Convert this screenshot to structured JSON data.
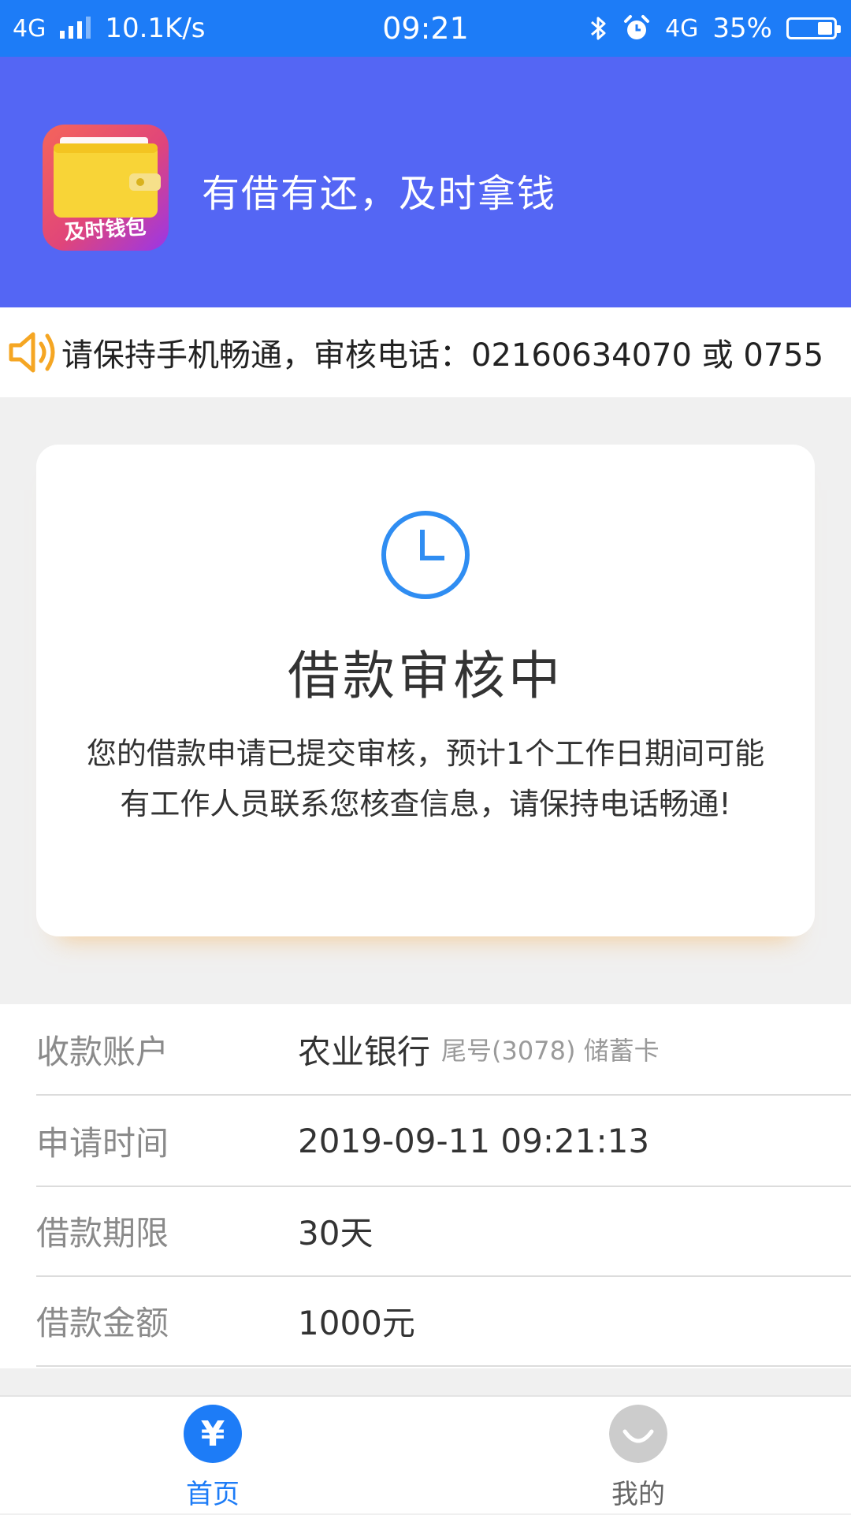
{
  "status_bar": {
    "network": "4G",
    "speed": "10.1K/s",
    "time": "09:21",
    "network_right": "4G",
    "battery": "35%",
    "battery_level": 0.35
  },
  "header": {
    "logo_text": "及时钱包",
    "slogan": "有借有还，及时拿钱",
    "background_color": "#5466f4"
  },
  "notice": {
    "text": "请保持手机畅通，审核电话：02160634070 或 0755"
  },
  "status_card": {
    "title": "借款审核中",
    "description": "您的借款申请已提交审核，预计1个工作日期间可能有工作人员联系您核查信息，请保持电话畅通!"
  },
  "info": {
    "account_label": "收款账户",
    "bank": "农业银行",
    "card_info": "尾号(3078) 储蓄卡",
    "time_label": "申请时间",
    "time_value": "2019-09-11 09:21:13",
    "term_label": "借款期限",
    "term_value": "30天",
    "amount_label": "借款金额",
    "amount_value": "1000元"
  },
  "tabs": {
    "home_icon_glyph": "¥",
    "home_label": "首页",
    "mine_label": "我的",
    "active_color": "#1d7cf7",
    "inactive_color": "#cccccc"
  }
}
